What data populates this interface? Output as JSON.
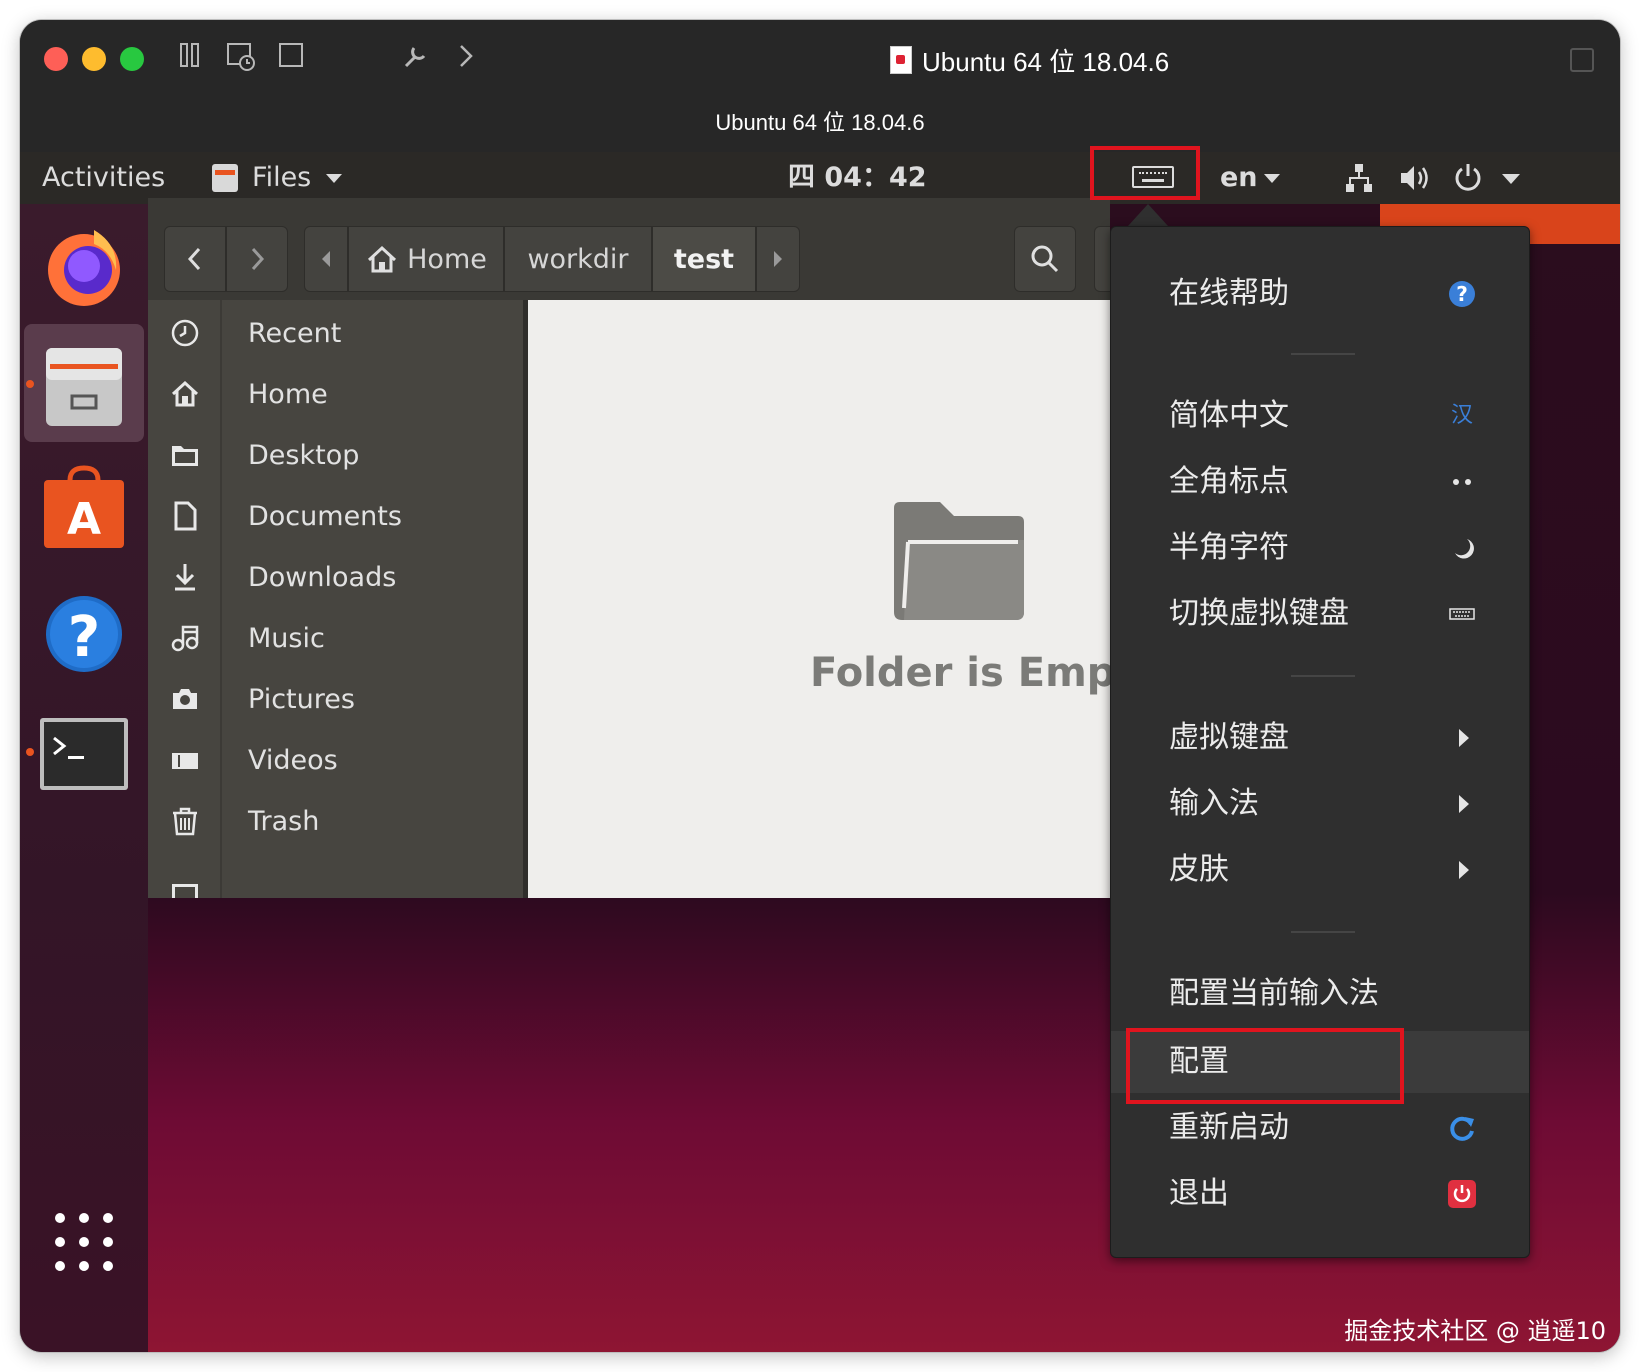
{
  "titlebar": {
    "title": "Ubuntu 64 位 18.04.6",
    "subtitle": "Ubuntu 64 位 18.04.6"
  },
  "topbar": {
    "activities": "Activities",
    "app_menu": "Files",
    "clock": "四 04：42",
    "keyboard_lang": "en"
  },
  "files": {
    "breadcrumbs": [
      "Home",
      "workdir",
      "test"
    ],
    "sidebar": [
      "Recent",
      "Home",
      "Desktop",
      "Documents",
      "Downloads",
      "Music",
      "Pictures",
      "Videos",
      "Trash"
    ],
    "empty_text": "Folder is Empty"
  },
  "menu": {
    "online_help": "在线帮助",
    "simplified_chinese": "简体中文",
    "fullwidth_punct": "全角标点",
    "halfwidth_char": "半角字符",
    "toggle_vkb": "切换虚拟键盘",
    "virtual_keyboard": "虚拟键盘",
    "input_method": "输入法",
    "skin": "皮肤",
    "configure_current_im": "配置当前输入法",
    "configure": "配置",
    "restart": "重新启动",
    "quit": "退出"
  },
  "watermark": "掘金技术社区 @ 逍遥10",
  "colors": {
    "highlight": "#e0141e",
    "ubuntu_orange": "#e95420",
    "menu_bg": "#2f2f2f"
  }
}
